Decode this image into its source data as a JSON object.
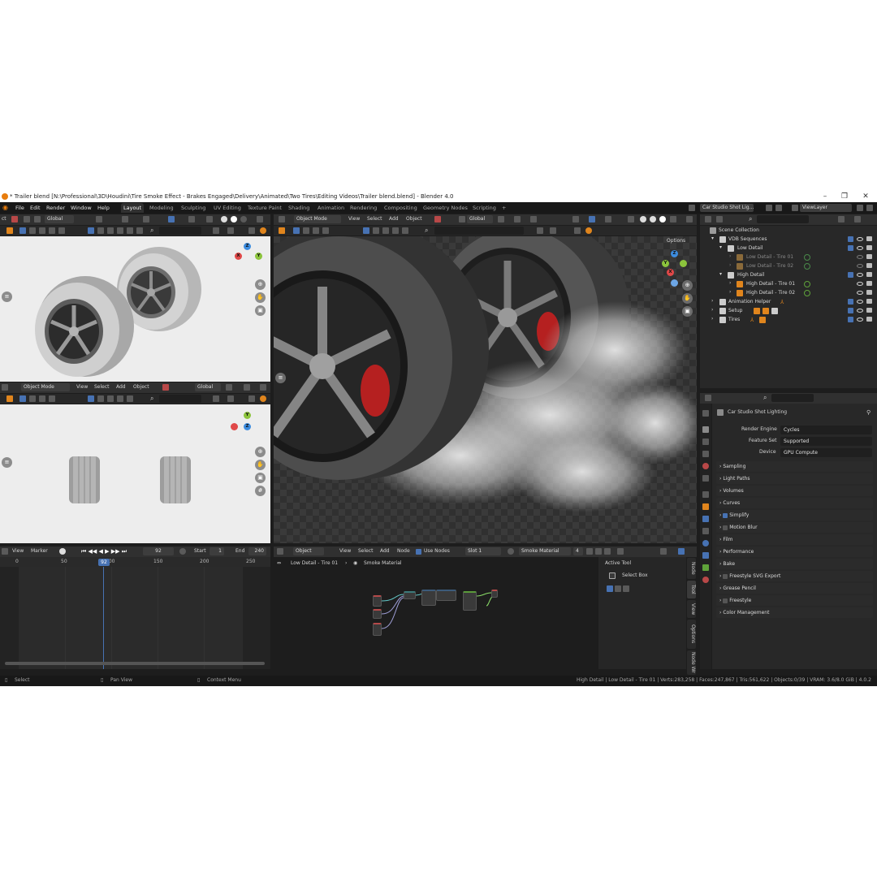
{
  "titlebar": {
    "title": "* Trailer blend [N:\\Professional\\3D\\Houdini\\Tire Smoke Effect - Brakes Engaged\\Delivery\\Animated\\Two Tires\\Editing Videos\\Trailer blend.blend] - Blender 4.0",
    "minimize": "–",
    "maximize": "❐",
    "close": "✕"
  },
  "menu": {
    "items": [
      "File",
      "Edit",
      "Render",
      "Window",
      "Help"
    ],
    "workspaces": [
      "Layout",
      "Modeling",
      "Sculpting",
      "UV Editing",
      "Texture Paint",
      "Shading",
      "Animation",
      "Rendering",
      "Compositing",
      "Geometry Nodes",
      "Scripting"
    ],
    "add_tab": "+",
    "scene_name": "Car Studio Shot Lig...",
    "view_layer": "ViewLayer"
  },
  "viewport_left_top": {
    "orientation": "Global",
    "cut_label": "ct"
  },
  "viewport_left_bottom": {
    "mode": "Object Mode",
    "menus": [
      "View",
      "Select",
      "Add",
      "Object"
    ],
    "orientation": "Global"
  },
  "viewport_main": {
    "mode": "Object Mode",
    "menus": [
      "View",
      "Select",
      "Add",
      "Object"
    ],
    "orientation": "Global",
    "options": "Options"
  },
  "gizmo": {
    "x": "X",
    "y": "Y",
    "z": "Z"
  },
  "outliner": {
    "root": "Scene Collection",
    "rows": [
      {
        "label": "VDB Sequences",
        "muted": false
      },
      {
        "label": "Low Detail",
        "muted": false
      },
      {
        "label": "Low Detail - Tire 01",
        "muted": true
      },
      {
        "label": "Low Detail - Tire 02",
        "muted": true
      },
      {
        "label": "High Detail",
        "muted": false
      },
      {
        "label": "High Detail - Tire 01",
        "muted": false
      },
      {
        "label": "High Detail - Tire 02",
        "muted": false
      },
      {
        "label": "Animation Helper",
        "muted": false
      },
      {
        "label": "Setup",
        "muted": false
      },
      {
        "label": "Tires",
        "muted": false
      }
    ]
  },
  "properties": {
    "scene_name": "Car Studio Shot Lighting",
    "render_engine_label": "Render Engine",
    "render_engine": "Cycles",
    "feature_set_label": "Feature Set",
    "feature_set": "Supported",
    "device_label": "Device",
    "device": "GPU Compute",
    "panels": [
      "Sampling",
      "Light Paths",
      "Volumes",
      "Curves",
      "Simplify",
      "Motion Blur",
      "Film",
      "Performance",
      "Bake",
      "Freestyle SVG Export",
      "Grease Pencil",
      "Freestyle",
      "Color Management"
    ]
  },
  "timeline": {
    "menus": [
      "View",
      "Marker"
    ],
    "current_frame": "92",
    "start_label": "Start",
    "start": "1",
    "end_label": "End",
    "end": "240",
    "ticks": [
      "0",
      "50",
      "100",
      "150",
      "200",
      "250"
    ],
    "playhead": "92"
  },
  "node_editor": {
    "type": "Object",
    "menus": [
      "View",
      "Select",
      "Add",
      "Node"
    ],
    "use_nodes": "Use Nodes",
    "slot": "Slot 1",
    "material": "Smoke Material",
    "users": "4",
    "breadcrumb_object": "Low Detail - Tire 01",
    "breadcrumb_material": "Smoke Material",
    "active_tool_label": "Active Tool",
    "active_tool": "Select Box",
    "side_tabs": [
      "Node",
      "Tool",
      "View",
      "Options",
      "Node Wr"
    ]
  },
  "status": {
    "select": "Select",
    "pan": "Pan View",
    "context": "Context Menu",
    "stats": "High Detail | Low Detail - Tire 01 | Verts:283,258 | Faces:247,867 | Tris:561,622 | Objects:0/39 | VRAM: 3.6/8.0 GiB | 4.0.2"
  },
  "colors": {
    "accent": "#4772b3",
    "blender_orange": "#e87d0d",
    "panel_bg": "#303030",
    "window_bg": "#1d1d1d"
  }
}
